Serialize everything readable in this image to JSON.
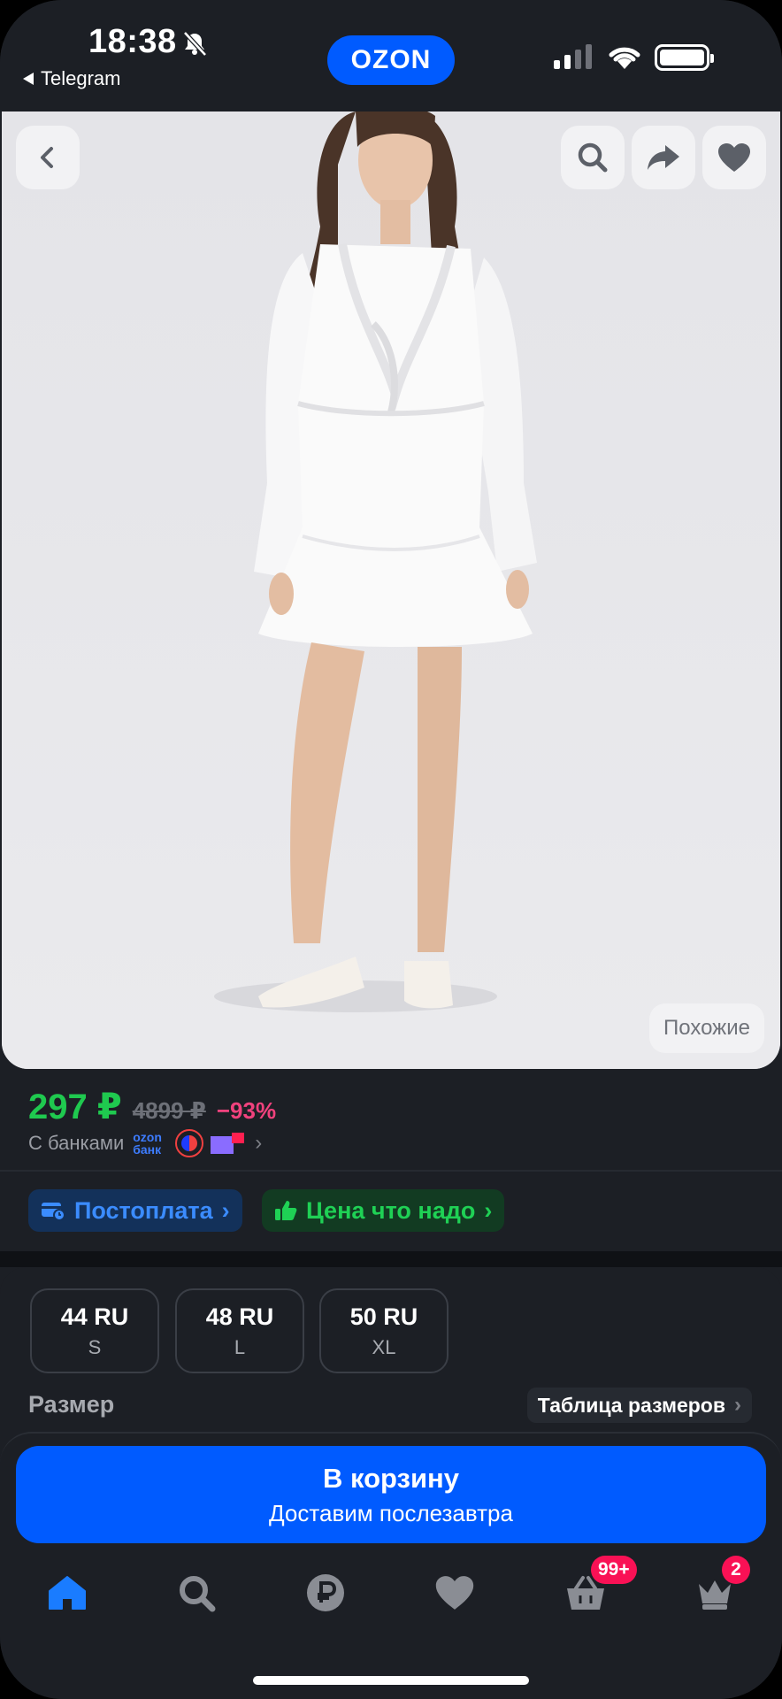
{
  "status_bar": {
    "time": "18:38",
    "back_app": "Telegram",
    "brand": "OZON"
  },
  "product": {
    "similar_label": "Похожие",
    "price": "297 ₽",
    "old_price": "4899 ₽",
    "discount": "−93%",
    "banks_label": "С банками",
    "bank_ozon_line1": "ozon",
    "bank_ozon_line2": "банк"
  },
  "chips": {
    "postpay": "Постоплата",
    "fair_price": "Цена что надо"
  },
  "sizes": {
    "items": [
      {
        "ru": "44 RU",
        "letter": "S"
      },
      {
        "ru": "48 RU",
        "letter": "L"
      },
      {
        "ru": "50 RU",
        "letter": "XL"
      }
    ],
    "label": "Размер",
    "table_link": "Таблица размеров"
  },
  "cart_button": {
    "title": "В корзину",
    "subtitle": "Доставим послезавтра"
  },
  "nav": {
    "cart_badge": "99+",
    "profile_badge": "2"
  },
  "colors": {
    "accent": "#005bff",
    "price_green": "#1fc94f",
    "discount_pink": "#f0427d",
    "background": "#1c1f25",
    "badge": "#f91155"
  }
}
